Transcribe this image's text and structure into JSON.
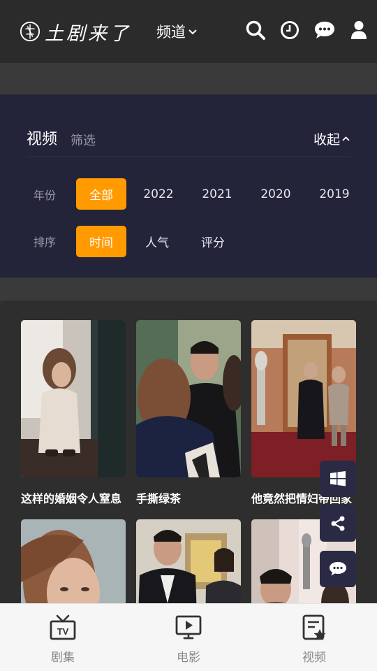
{
  "header": {
    "logo_text": "土剧来了",
    "channel_label": "频道",
    "icons": [
      "search-icon",
      "history-icon",
      "message-icon",
      "user-icon"
    ]
  },
  "filter": {
    "title": "视频",
    "subtitle": "筛选",
    "collapse_label": "收起",
    "year": {
      "label": "年份",
      "options": [
        "全部",
        "2022",
        "2021",
        "2020",
        "2019"
      ],
      "selected": "全部"
    },
    "sort": {
      "label": "排序",
      "options": [
        "时间",
        "人气",
        "评分"
      ],
      "selected": "时间"
    },
    "accent_color": "#ff9a00"
  },
  "videos": [
    {
      "title": "这样的婚姻令人窒息"
    },
    {
      "title": "手撕绿茶"
    },
    {
      "title": "他竟然把情妇带回家"
    },
    {
      "title": ""
    },
    {
      "title": ""
    },
    {
      "title": ""
    }
  ],
  "fabs": [
    "windows-icon",
    "share-icon",
    "chat-icon"
  ],
  "bottom_nav": [
    {
      "label": "剧集",
      "icon": "tv-icon"
    },
    {
      "label": "电影",
      "icon": "movie-icon"
    },
    {
      "label": "视频",
      "icon": "video-star-icon"
    }
  ]
}
